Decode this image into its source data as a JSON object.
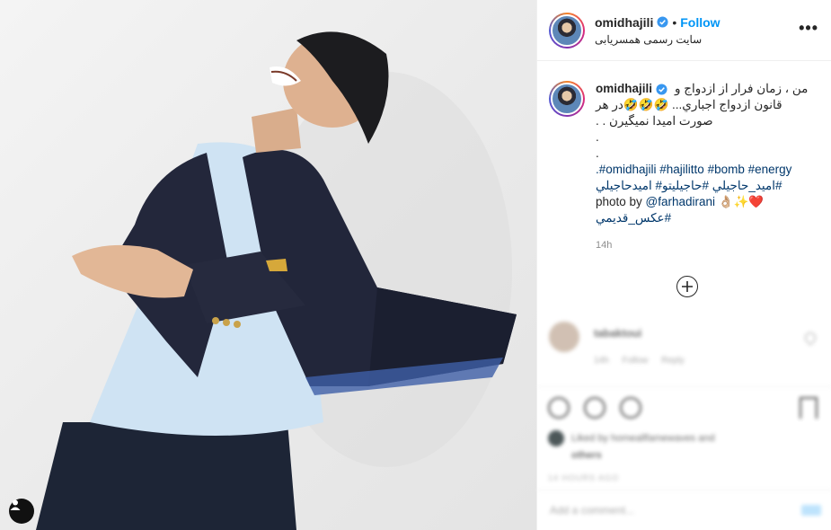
{
  "post": {
    "username": "omidhajili",
    "follow_label": "Follow",
    "location": "سایت رسمی همسریابی",
    "more_label": "•••"
  },
  "caption": {
    "line1": "من ، زمان فرار از ازدواج و",
    "line2": "قانون ازدواج اجباري... 🤣🤣🤣در هر",
    "line3": "صورت امیدا نمیگیرن . .",
    "dot1": ".",
    "dot2": ".",
    "hashtags1": ".#omidhajili #hajilitto #bomb #energy",
    "hashtags2": "#امید_حاجیلي #حاجیلیتو# امیدحاجیلي",
    "photo_by_prefix": "photo by ",
    "photo_by_handle": "@farhadirani",
    "photo_by_suffix": " 👌🏼✨❤️",
    "hashtag3": "#عکس_قديمي",
    "time": "14h"
  },
  "comment": {
    "username": "tabaktoui",
    "meta": "14h Follow Reply"
  },
  "likes": {
    "line1": "Liked by homeallfamewaves and",
    "line2": "others"
  },
  "date_text": "14 HOURS AGO",
  "add_comment_placeholder": "Add a comment...",
  "colors": {
    "accent": "#0095f6",
    "hashtag": "#00376b",
    "verified": "#3897f0"
  }
}
